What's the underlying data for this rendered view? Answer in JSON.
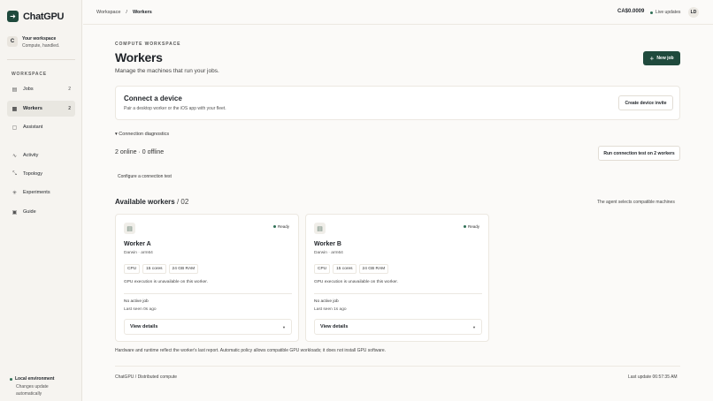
{
  "brand": {
    "name": "ChatGPU",
    "icon": "arrow-right-icon"
  },
  "workspace": {
    "avatar": "C",
    "name": "Your workspace",
    "tagline": "Compute, handled."
  },
  "sidebar": {
    "section_label": "WORKSPACE",
    "items": [
      {
        "label": "Jobs",
        "count": "2",
        "icon": "jobs-icon"
      },
      {
        "label": "Workers",
        "count": "2",
        "icon": "workers-icon",
        "active": true
      },
      {
        "label": "Assistant",
        "icon": "assistant-icon"
      },
      {
        "label": "Activity",
        "icon": "activity-icon"
      },
      {
        "label": "Topology",
        "icon": "topology-icon"
      },
      {
        "label": "Experiments",
        "icon": "experiments-icon"
      },
      {
        "label": "Guide",
        "icon": "guide-icon"
      }
    ]
  },
  "environment": {
    "title": "Local environment",
    "subtitle": "Changes update automatically"
  },
  "topbar": {
    "breadcrumb": [
      "Workspace",
      "Workers"
    ],
    "separator": "/",
    "credit": "CA$0.0009",
    "live_label": "Live updates",
    "user_initials": "LD"
  },
  "header": {
    "eyebrow": "COMPUTE WORKSPACE",
    "title": "Workers",
    "subtitle": "Manage the machines that run your jobs.",
    "new_job_label": "New job"
  },
  "connect": {
    "title": "Connect a device",
    "subtitle": "Pair a desktop worker or the iOS app with your fleet.",
    "button_label": "Create device invite"
  },
  "diagnostics": {
    "toggle_label": "▾ Connection diagnostics",
    "status": "2 online · 0 offline",
    "run_label": "Run connection test on 2 workers",
    "config_label": "Configure a connection test"
  },
  "available": {
    "title": "Available workers",
    "count": "/ 02",
    "note": "The agent selects compatible machines"
  },
  "workers": [
    {
      "status": "Ready",
      "name": "Worker A",
      "os": "Darwin · arm64",
      "chips": [
        "CPU",
        "15 cores",
        "24 GB RAM"
      ],
      "gpu": "GPU execution is unavailable on this worker.",
      "job": "No active job",
      "seen": "Last seen 0s ago",
      "details_label": "View details"
    },
    {
      "status": "Ready",
      "name": "Worker B",
      "os": "Darwin · arm64",
      "chips": [
        "CPU",
        "15 cores",
        "24 GB RAM"
      ],
      "gpu": "GPU execution is unavailable on this worker.",
      "job": "No active job",
      "seen": "Last seen 1s ago",
      "details_label": "View details"
    }
  ],
  "footnote": "Hardware and runtime reflect the worker's last report. Automatic policy allows compatible GPU workloads; it does not install GPU software.",
  "footer": {
    "left": "ChatGPU / Distributed compute",
    "right": "Last update 06:57:35 AM"
  },
  "colors": {
    "accent": "#1f4a3d",
    "ready": "#2f6f55"
  }
}
